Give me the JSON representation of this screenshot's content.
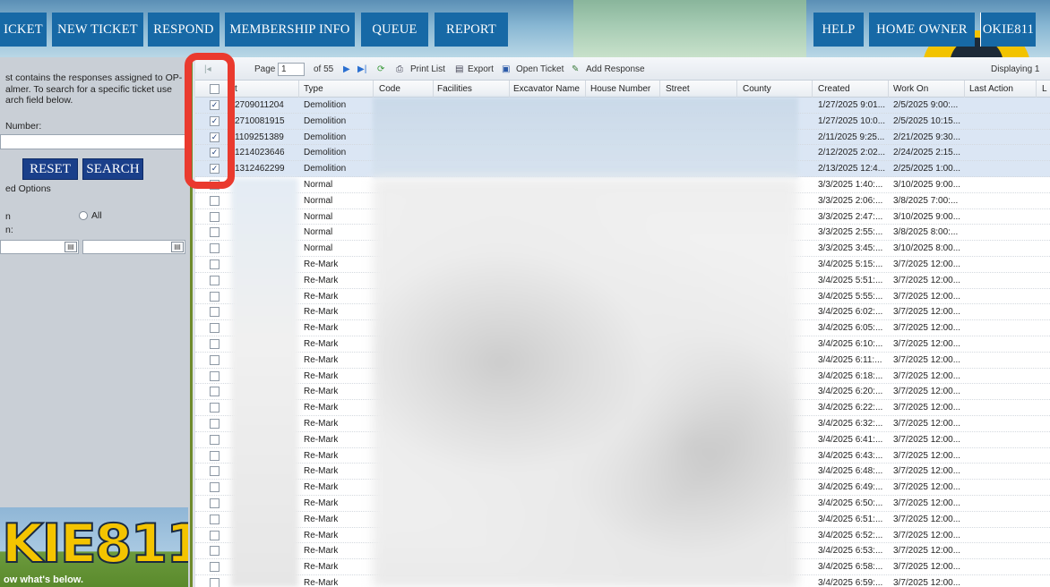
{
  "nav": {
    "ticket": "ICKET",
    "new_ticket": "NEW TICKET",
    "respond": "RESPOND",
    "membership": "MEMBERSHIP INFO",
    "queue": "QUEUE",
    "report": "REPORT",
    "help": "HELP",
    "home_owner": "HOME OWNER",
    "user": "OKIE811"
  },
  "left": {
    "description": "st contains the responses assigned to OP-almer. To search for a specific ticket use arch field below.",
    "number_label": "Number:",
    "reset_label": "RESET",
    "search_label": "SEARCH",
    "options_label": "ed Options",
    "n_label": "n",
    "all_label": "All",
    "n2_label": "n:",
    "banner_text": "KIE811",
    "banner_tag": "ow what's below."
  },
  "toolbar": {
    "page_label": "Page",
    "page_value": "1",
    "of_label": "of 55",
    "print_list": "Print List",
    "export": "Export",
    "open_ticket": "Open Ticket",
    "add_response": "Add Response",
    "displaying": "Displaying 1"
  },
  "columns": {
    "ticket": "t",
    "type": "Type",
    "code": "Code",
    "facilities": "Facilities",
    "excavator": "Excavator Name",
    "house": "House Number",
    "street": "Street",
    "county": "County",
    "created": "Created",
    "work_on": "Work On",
    "last_action": "Last Action",
    "l": "L"
  },
  "rows": [
    {
      "checked": true,
      "ticket": "2709011204",
      "type": "Demolition",
      "created": "1/27/2025 9:01...",
      "work_on": "2/5/2025 9:00:..."
    },
    {
      "checked": true,
      "ticket": "2710081915",
      "type": "Demolition",
      "created": "1/27/2025 10:0...",
      "work_on": "2/5/2025 10:15..."
    },
    {
      "checked": true,
      "ticket": "1109251389",
      "type": "Demolition",
      "created": "2/11/2025 9:25...",
      "work_on": "2/21/2025 9:30..."
    },
    {
      "checked": true,
      "ticket": "1214023646",
      "type": "Demolition",
      "created": "2/12/2025 2:02...",
      "work_on": "2/24/2025 2:15..."
    },
    {
      "checked": true,
      "ticket": "1312462299",
      "type": "Demolition",
      "created": "2/13/2025 12:4...",
      "work_on": "2/25/2025 1:00..."
    },
    {
      "checked": false,
      "ticket": "",
      "type": "Normal",
      "created": "3/3/2025 1:40:...",
      "work_on": "3/10/2025 9:00..."
    },
    {
      "checked": false,
      "ticket": "",
      "type": "Normal",
      "created": "3/3/2025 2:06:...",
      "work_on": "3/8/2025 7:00:..."
    },
    {
      "checked": false,
      "ticket": "",
      "type": "Normal",
      "created": "3/3/2025 2:47:...",
      "work_on": "3/10/2025 9:00..."
    },
    {
      "checked": false,
      "ticket": "",
      "type": "Normal",
      "created": "3/3/2025 2:55:...",
      "work_on": "3/8/2025 8:00:..."
    },
    {
      "checked": false,
      "ticket": "",
      "type": "Normal",
      "created": "3/3/2025 3:45:...",
      "work_on": "3/10/2025 8:00..."
    },
    {
      "checked": false,
      "ticket": "",
      "type": "Re-Mark",
      "created": "3/4/2025 5:15:...",
      "work_on": "3/7/2025 12:00..."
    },
    {
      "checked": false,
      "ticket": "",
      "type": "Re-Mark",
      "created": "3/4/2025 5:51:...",
      "work_on": "3/7/2025 12:00..."
    },
    {
      "checked": false,
      "ticket": "",
      "type": "Re-Mark",
      "created": "3/4/2025 5:55:...",
      "work_on": "3/7/2025 12:00..."
    },
    {
      "checked": false,
      "ticket": "",
      "type": "Re-Mark",
      "created": "3/4/2025 6:02:...",
      "work_on": "3/7/2025 12:00..."
    },
    {
      "checked": false,
      "ticket": "",
      "type": "Re-Mark",
      "created": "3/4/2025 6:05:...",
      "work_on": "3/7/2025 12:00..."
    },
    {
      "checked": false,
      "ticket": "",
      "type": "Re-Mark",
      "created": "3/4/2025 6:10:...",
      "work_on": "3/7/2025 12:00..."
    },
    {
      "checked": false,
      "ticket": "",
      "type": "Re-Mark",
      "created": "3/4/2025 6:11:...",
      "work_on": "3/7/2025 12:00..."
    },
    {
      "checked": false,
      "ticket": "",
      "type": "Re-Mark",
      "created": "3/4/2025 6:18:...",
      "work_on": "3/7/2025 12:00..."
    },
    {
      "checked": false,
      "ticket": "",
      "type": "Re-Mark",
      "created": "3/4/2025 6:20:...",
      "work_on": "3/7/2025 12:00..."
    },
    {
      "checked": false,
      "ticket": "",
      "type": "Re-Mark",
      "created": "3/4/2025 6:22:...",
      "work_on": "3/7/2025 12:00..."
    },
    {
      "checked": false,
      "ticket": "",
      "type": "Re-Mark",
      "created": "3/4/2025 6:32:...",
      "work_on": "3/7/2025 12:00..."
    },
    {
      "checked": false,
      "ticket": "",
      "type": "Re-Mark",
      "created": "3/4/2025 6:41:...",
      "work_on": "3/7/2025 12:00..."
    },
    {
      "checked": false,
      "ticket": "",
      "type": "Re-Mark",
      "created": "3/4/2025 6:43:...",
      "work_on": "3/7/2025 12:00..."
    },
    {
      "checked": false,
      "ticket": "",
      "type": "Re-Mark",
      "created": "3/4/2025 6:48:...",
      "work_on": "3/7/2025 12:00..."
    },
    {
      "checked": false,
      "ticket": "",
      "type": "Re-Mark",
      "created": "3/4/2025 6:49:...",
      "work_on": "3/7/2025 12:00..."
    },
    {
      "checked": false,
      "ticket": "",
      "type": "Re-Mark",
      "created": "3/4/2025 6:50:...",
      "work_on": "3/7/2025 12:00..."
    },
    {
      "checked": false,
      "ticket": "",
      "type": "Re-Mark",
      "created": "3/4/2025 6:51:...",
      "work_on": "3/7/2025 12:00..."
    },
    {
      "checked": false,
      "ticket": "",
      "type": "Re-Mark",
      "created": "3/4/2025 6:52:...",
      "work_on": "3/7/2025 12:00..."
    },
    {
      "checked": false,
      "ticket": "",
      "type": "Re-Mark",
      "created": "3/4/2025 6:53:...",
      "work_on": "3/7/2025 12:00..."
    },
    {
      "checked": false,
      "ticket": "",
      "type": "Re-Mark",
      "created": "3/4/2025 6:58:...",
      "work_on": "3/7/2025 12:00..."
    },
    {
      "checked": false,
      "ticket": "",
      "type": "Re-Mark",
      "created": "3/4/2025 6:59:...",
      "work_on": "3/7/2025 12:00..."
    }
  ],
  "colors": {
    "nav_button": "#1769a6",
    "action_button": "#1a3f8a",
    "highlight": "#ea3a2e",
    "selected_row": "#dbe6f4"
  }
}
